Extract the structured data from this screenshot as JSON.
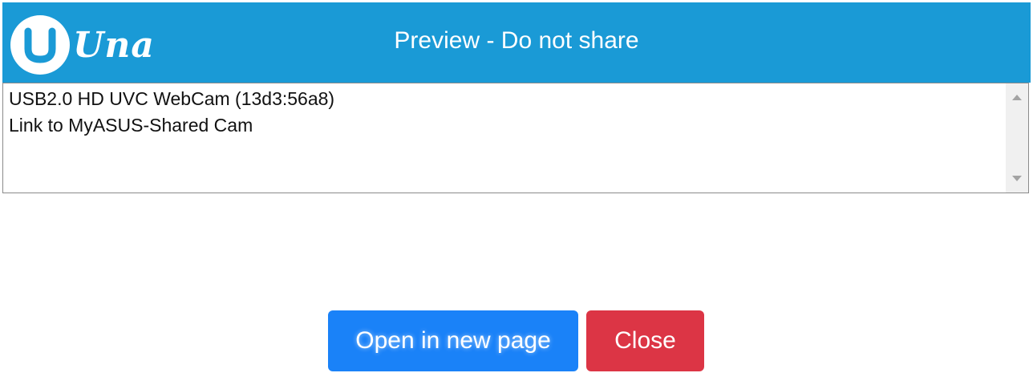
{
  "header": {
    "logo_text": "Una",
    "title": "Preview - Do not share",
    "background_color": "#1a9ad6"
  },
  "device_list": {
    "items": [
      {
        "label": "USB2.0 HD UVC WebCam (13d3:56a8)"
      },
      {
        "label": "Link to MyASUS-Shared Cam"
      }
    ]
  },
  "buttons": {
    "open_label": "Open in new page",
    "close_label": "Close",
    "open_color": "#1a82f8",
    "close_color": "#dc3545"
  },
  "icons": {
    "logo": "una-logo-icon",
    "scroll_up": "scroll-up-arrow-icon",
    "scroll_down": "scroll-down-arrow-icon"
  }
}
